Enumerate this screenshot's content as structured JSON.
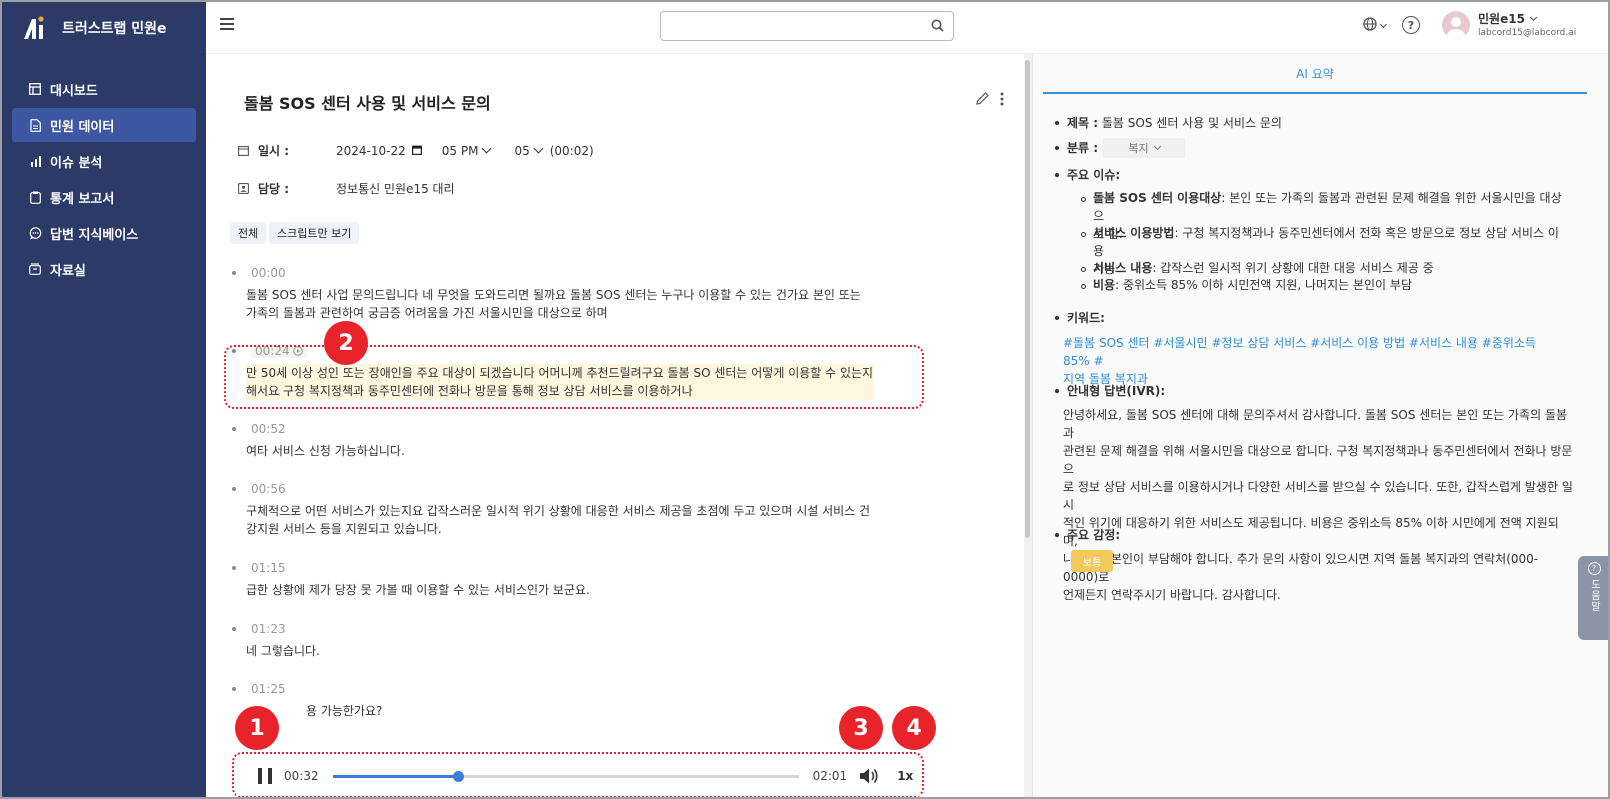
{
  "app": {
    "name": "트러스트랩 민원e"
  },
  "sidebar": {
    "items": [
      {
        "label": "대시보드",
        "icon": "dashboard-icon"
      },
      {
        "label": "민원 데이터",
        "icon": "document-icon",
        "active": true
      },
      {
        "label": "이슈 분석",
        "icon": "bar-chart-icon"
      },
      {
        "label": "통계 보고서",
        "icon": "clipboard-icon"
      },
      {
        "label": "답변 지식베이스",
        "icon": "chat-bubble-icon"
      },
      {
        "label": "자료실",
        "icon": "archive-icon"
      }
    ]
  },
  "header": {
    "search_placeholder": "",
    "user_name": "민원e15",
    "user_email": "labcord15@labcord.ai"
  },
  "record": {
    "title": "돌봄 SOS 센터 사용 및 서비스 문의",
    "date_label": "일시 :",
    "date": "2024-10-22",
    "hour": "05 PM",
    "minute": "05",
    "duration": "(00:02)",
    "owner_label": "담당 :",
    "owner": "정보통신 민원e15 대리"
  },
  "filters": {
    "all": "전체",
    "script_only": "스크립트만 보기"
  },
  "transcript": [
    {
      "time": "00:00",
      "text": "돌봄 SOS 센터 사업 문의드립니다 네 무엇을 도와드리면 될까요 돌봄 SOS 센터는 누구나 이용할 수 있는 건가요 본인 또는 가족의 돌봄과 관련하여 궁금증 어려움을 가진 서울시민을 대상으로 하며"
    },
    {
      "time": "00:24",
      "text": "만 50세 이상 성인 또는 장애인을 주요 대상이 되겠습니다 어머니께 추천드릴려구요 돌봄 SO 센터는 어떻게 이용할 수 있는지 해서요 구청 복지정책과 동주민센터에 전화나 방문을 통해 정보 상담 서비스를 이용하거나",
      "highlight": true
    },
    {
      "time": "00:52",
      "text": "여타 서비스 신청 가능하십니다."
    },
    {
      "time": "00:56",
      "text": "구체적으로 어떤 서비스가 있는지요 갑작스러운 일시적 위기 상황에 대응한 서비스 제공을 초점에 두고 있으며 시설 서비스 건강지원 서비스 등을 지원되고 있습니다."
    },
    {
      "time": "01:15",
      "text": "급한 상황에 제가 당장 못 가볼 때 이용할 수 있는 서비스인가 보군요."
    },
    {
      "time": "01:23",
      "text": "네 그렇습니다."
    },
    {
      "time": "01:25",
      "text": "용 가능한가요?"
    }
  ],
  "player": {
    "current": "00:32",
    "total": "02:01",
    "speed": "1x",
    "progress": 0.27
  },
  "markers": [
    "1",
    "2",
    "3",
    "4"
  ],
  "ai": {
    "tab": "AI 요약",
    "title_label": "제목 :",
    "title": "돌봄 SOS 센터 사용 및 서비스 문의",
    "category_label": "분류 :",
    "category": "복지",
    "issues_label": "주요 이슈:",
    "issues": [
      {
        "head": "돌봄 SOS 센터 이용대상",
        "line1": ": 본인 또는 가족의 돌봄과 관련된 문제 해결을 위한 서울시민을 대상으",
        "line2": "로 함."
      },
      {
        "head": "서비스 이용방법",
        "line1": ": 구청 복지정책과나 동주민센터에서 전화 혹은 방문으로 정보 상담 서비스 이용",
        "line2": "가능"
      },
      {
        "head": "서비스 내용",
        "line1": ": 갑작스런 일시적 위기 상황에 대한 대응 서비스 제공 중",
        "line2": ""
      },
      {
        "head": "비용",
        "line1": ": 중위소득 85% 이하 시민전액 지원, 나머지는 본인이 부담",
        "line2": ""
      }
    ],
    "keywords_label": "키워드:",
    "keywords_line1": "#돌봄 SOS 센터  #서울시민  #정보 상담 서비스  #서비스 이용 방법  #서비스 내용  #중위소득 85%  #",
    "keywords_line2": "지역 돌봄 복지과",
    "ivr_label": "안내형 답변(IVR):",
    "ivr_lines": [
      "안녕하세요, 돌봄 SOS 센터에 대해 문의주셔서 감사합니다. 돌봄 SOS 센터는 본인 또는 가족의 돌봄과",
      "관련된 문제 해결을 위해 서울시민을 대상으로 합니다. 구청 복지정책과나 동주민센터에서 전화나 방문으",
      "로 정보 상담 서비스를 이용하시거나 다양한 서비스를 받으실 수 있습니다. 또한, 갑작스럽게 발생한 일시",
      "적인 위기에 대응하기 위한 서비스도 제공됩니다. 비용은 중위소득 85% 이하 시민에게 전액 지원되며,",
      "나머지는 본인이 부담해야 합니다. 추가 문의 사항이 있으시면 지역 돌봄 복지과의 연락처(000-0000)로",
      "언제든지 연락주시기 바랍니다. 감사합니다."
    ],
    "emotion_label": "주요 감정:",
    "emotion": "보통"
  },
  "help_float": "도움말",
  "colors": {
    "sidebar": "#2b3a67",
    "active": "#3d57a3",
    "accent": "#3b8fd9",
    "marker": "#e8232a",
    "badge": "#f3c95b"
  }
}
